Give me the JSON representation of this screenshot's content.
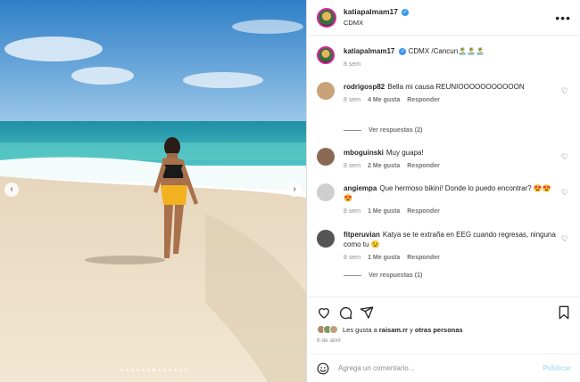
{
  "header": {
    "username": "katiapalmam17",
    "location": "CDMX",
    "more_icon": "more-options-icon"
  },
  "carousel": {
    "slide_count": 13,
    "active_index": 6
  },
  "caption": {
    "username": "katiapalmam17",
    "text": "CDMX /Cancun🏝️🏝️🏝️",
    "time": "8 sem"
  },
  "comments": [
    {
      "username": "rodrigosp82",
      "text": "Bella mi causa REUNIOOOOOOOOOOON",
      "time": "8 sem",
      "likes": "4 Me gusta",
      "reply": "Responder",
      "replies": "Ver respuestas (2)"
    },
    {
      "username": "mboguinski",
      "text": "Muy guapa!",
      "time": "8 sem",
      "likes": "2 Me gusta",
      "reply": "Responder"
    },
    {
      "username": "angiempa",
      "text": "Que hermoso bikini! Donde lo puedo encontrar? 😍😍😍",
      "time": "8 sem",
      "likes": "1 Me gusta",
      "reply": "Responder"
    },
    {
      "username": "fitperuvian",
      "text": "Katya se te extraña en EEG cuando regresas, ninguna como tu 😉",
      "time": "8 sem",
      "likes": "1 Me gusta",
      "reply": "Responder",
      "replies": "Ver respuestas (1)"
    }
  ],
  "likes_bar": {
    "prefix": "Les gusta a",
    "user": "raisam.rr",
    "joiner": "y",
    "others": "otras personas"
  },
  "date": "6 de abril",
  "add_comment": {
    "placeholder": "Agrega un comentario...",
    "post_label": "Publicar"
  },
  "colors": {
    "verified": "#3897f0",
    "post_disabled": "#b2dffc",
    "ring": "#d6249f"
  }
}
